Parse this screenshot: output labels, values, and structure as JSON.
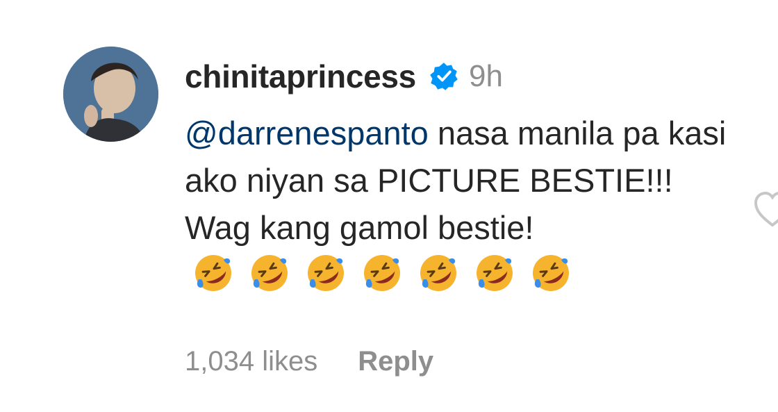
{
  "comment": {
    "username": "chinitaprincess",
    "verified": true,
    "time": "9h",
    "mention": "@darrenespanto",
    "text": "nasa manila pa kasi ako niyan sa PICTURE BESTIE!!! Wag kang gamol bestie!",
    "emoji_icon": "rolling-on-floor-laughing-emoji",
    "emoji_count": 7,
    "likes": "1,034 likes",
    "reply_label": "Reply"
  },
  "colors": {
    "text": "#262626",
    "muted": "#8e8e8e",
    "mention": "#00376b",
    "verified_badge": "#0095f6"
  }
}
